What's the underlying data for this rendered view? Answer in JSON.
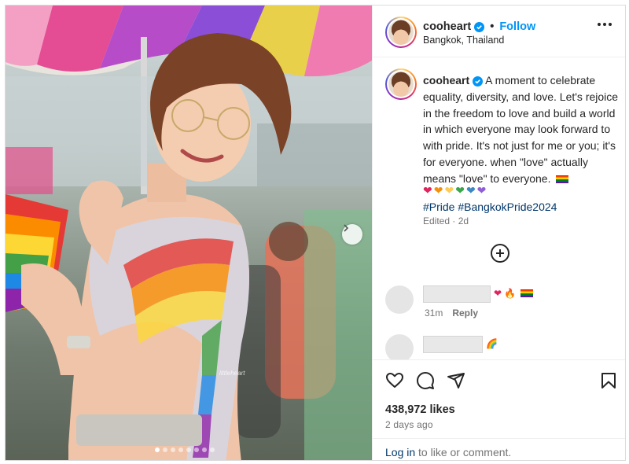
{
  "post": {
    "username": "cooheart",
    "follow_label": "Follow",
    "separator": "•",
    "location": "Bangkok, Thailand",
    "caption": "A moment to celebrate equality, diversity, and love. Let's rejoice in the freedom to love and build a world in which everyone may look forward to with pride. It's not just for me or you; it's for everyone. when \"love\" actually means \"love\" to everyone.",
    "hearts": [
      "❤",
      "❤",
      "❤",
      "❤",
      "❤",
      "❤"
    ],
    "heart_colors": [
      "#e0245e",
      "#f4900c",
      "#fdcb58",
      "#3aa64c",
      "#3b88c3",
      "#8f5fd3"
    ],
    "hashtags": [
      "#Pride",
      "#BangkokPride2024"
    ],
    "edited": "Edited · 2d",
    "likes": "438,972 likes",
    "posted_ago": "2 days ago",
    "photo_watermark": "littleheart",
    "carousel_dots": 8,
    "carousel_active": 0
  },
  "comments": [
    {
      "emoji": [
        "❤",
        "🔥",
        "flag"
      ],
      "time": "31m",
      "reply_label": "Reply"
    },
    {
      "emoji": [
        "🌈"
      ]
    }
  ],
  "login": {
    "link": "Log in",
    "text": " to like or comment."
  },
  "icons": [
    "more-options-icon",
    "verified-icon",
    "heart-icon",
    "comment-icon",
    "share-icon",
    "bookmark-icon",
    "add-circle-icon",
    "chevron-right-icon"
  ],
  "colors": {
    "accent": "#0095f6",
    "link": "#00376b",
    "muted": "#737373"
  }
}
